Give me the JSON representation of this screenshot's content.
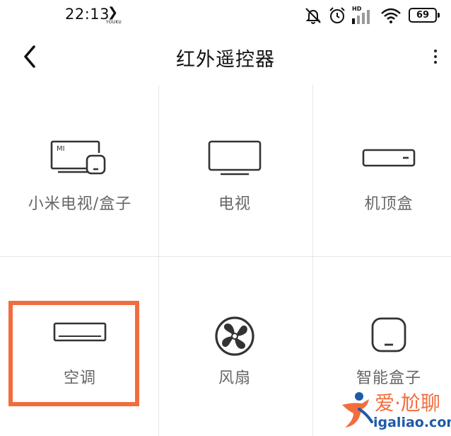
{
  "status_bar": {
    "time": "22:13",
    "app_badge": "YOUKU",
    "network_label": "HD",
    "battery_level": "69"
  },
  "header": {
    "title": "红外遥控器"
  },
  "devices": [
    {
      "label": "小米电视/盒子",
      "icon": "mi-tv-box-icon"
    },
    {
      "label": "电视",
      "icon": "tv-icon"
    },
    {
      "label": "机顶盒",
      "icon": "set-top-box-icon"
    },
    {
      "label": "空调",
      "icon": "air-conditioner-icon",
      "highlighted": true
    },
    {
      "label": "风扇",
      "icon": "fan-icon"
    },
    {
      "label": "智能盒子",
      "icon": "smart-box-icon"
    }
  ],
  "tv_logo_text": "MI",
  "watermark": {
    "top_text": "爱·尬聊",
    "url": "igaliao.com"
  },
  "colors": {
    "highlight": "#f26d3d",
    "icon_stroke": "#333333",
    "label": "#666666",
    "divider": "#e6e6e6",
    "watermark_blue": "#1e5aa8"
  }
}
